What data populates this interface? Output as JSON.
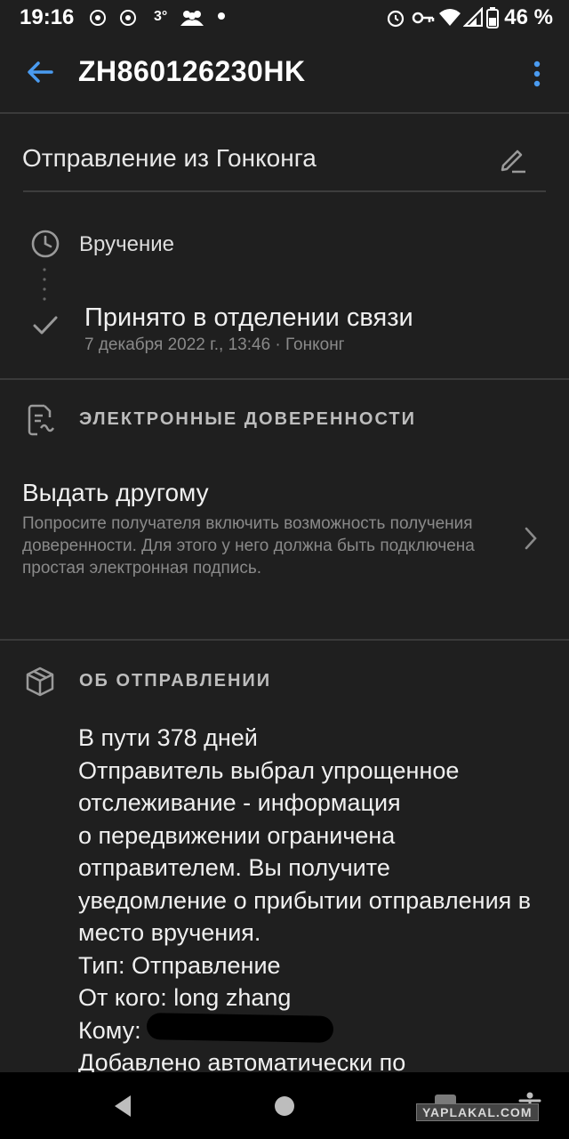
{
  "status_bar": {
    "time": "19:16",
    "temperature": "3°",
    "battery": "46 %"
  },
  "app_bar": {
    "title": "ZH860126230HK"
  },
  "shipment": {
    "name": "Отправление из Гонконга"
  },
  "tracking": {
    "steps": [
      {
        "label": "Вручение"
      },
      {
        "label": "Принято в отделении связи",
        "detail": "7 декабря 2022 г., 13:46 · Гонконг"
      }
    ]
  },
  "proxies": {
    "heading": "ЭЛЕКТРОННЫЕ ДОВЕРЕННОСТИ",
    "give_title": "Выдать другому",
    "give_description": "Попросите получателя включить возможность получения доверенности. Для этого у него должна быть подключена простая электронная подпись."
  },
  "about": {
    "heading": "ОБ ОТПРАВЛЕНИИ",
    "text": "В пути 378 дней\nОтправитель выбрал упрощенное отслеживание - информация\nо передвижении ограничена отправителем. Вы получите уведомление о прибытии отправления в место вручения.\nТип: Отправление\nОт кого: long zhang\nКому:\nДобавлено автоматически по"
  },
  "watermark": "YAPLAKAL.COM",
  "colors": {
    "background": "#1f1f1f",
    "accent": "#4a9bf0",
    "secondary_text": "#8a8a8a"
  }
}
